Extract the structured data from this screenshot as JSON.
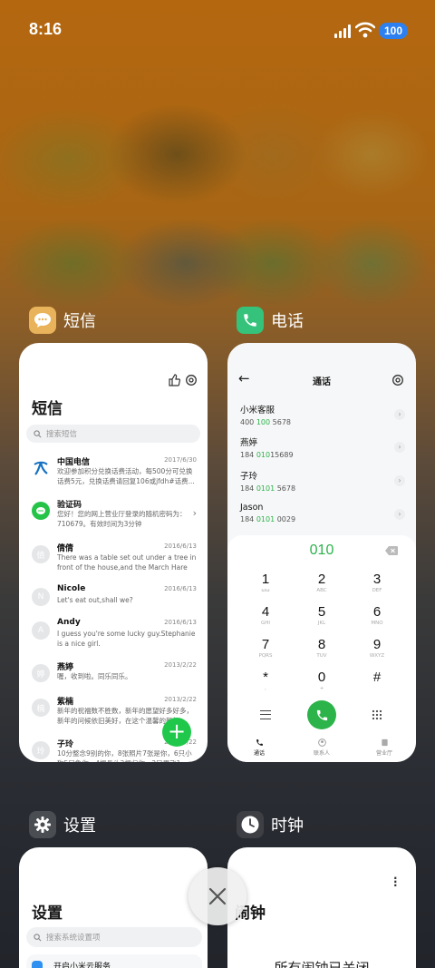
{
  "status_bar": {
    "time": "8:16",
    "battery": "100"
  },
  "apps": {
    "sms": {
      "name": "短信",
      "title": "短信",
      "search_placeholder": "搜索短信",
      "messages": [
        {
          "name": "中国电信",
          "date": "2017/6/30",
          "preview": "欢迎参加积分兑换话费活动，每500分可兑换话费5元，兑换话费请回复106或jfdh#话费..."
        },
        {
          "name": "验证码",
          "date": "",
          "preview": "您好！您的网上营业厅登录的随机密码为：710679。有效时间为3分钟"
        },
        {
          "name": "倩倩",
          "date": "2016/6/13",
          "avatar": "倩",
          "preview": "There was a table set out under a tree in front of the house,and the March Hare an..."
        },
        {
          "name": "Nicole",
          "date": "2016/6/13",
          "avatar": "N",
          "preview": "Let's eat out,shall we?"
        },
        {
          "name": "Andy",
          "date": "2016/6/13",
          "avatar": "A",
          "preview": "I guess you're some lucky guy.Stephanie is a nice girl."
        },
        {
          "name": "燕婷",
          "date": "2013/2/22",
          "avatar": "婷",
          "preview": "喔，收到啦。同乐同乐。"
        },
        {
          "name": "紫楠",
          "date": "2013/2/22",
          "avatar": "楠",
          "preview": "新年的祝福数不胜数，新年的愿望好多好多，新年的问候依旧美好，在这个温馨的新年..."
        },
        {
          "name": "子玲",
          "date": "2013/2/22",
          "avatar": "玲",
          "preview": "10分整念9别的你，8张照片7张是你，6只小狗5只象你，4根骨头3根归你，2只眉飞1..."
        }
      ]
    },
    "phone": {
      "name": "电话",
      "title": "通话",
      "contacts": [
        {
          "name": "小米客服",
          "pre": "400 ",
          "hl": "100",
          "post": " 5678"
        },
        {
          "name": "燕婷",
          "pre": "184 ",
          "hl": "010",
          "post": "15689"
        },
        {
          "name": "子玲",
          "pre": "184 ",
          "hl": "0101",
          "post": " 5678"
        },
        {
          "name": "Jason",
          "pre": "184 ",
          "hl": "0101",
          "post": " 0029"
        }
      ],
      "dialed": "010",
      "keys": [
        {
          "d": "1",
          "l": "ωω"
        },
        {
          "d": "2",
          "l": "ABC"
        },
        {
          "d": "3",
          "l": "DEF"
        },
        {
          "d": "4",
          "l": "GHI"
        },
        {
          "d": "5",
          "l": "JKL"
        },
        {
          "d": "6",
          "l": "MNO"
        },
        {
          "d": "7",
          "l": "PQRS"
        },
        {
          "d": "8",
          "l": "TUV"
        },
        {
          "d": "9",
          "l": "WXYZ"
        },
        {
          "d": "*",
          "l": ","
        },
        {
          "d": "0",
          "l": "+"
        },
        {
          "d": "#",
          "l": ""
        }
      ],
      "tabs": [
        "通话",
        "联系人",
        "营业厅"
      ]
    },
    "settings": {
      "name": "设置",
      "title": "设置",
      "search_placeholder": "搜索系统设置项",
      "first_item": "开启小米云服务"
    },
    "clock": {
      "name": "时钟",
      "title": "闹钟",
      "empty_text": "所有闹钟已关闭"
    }
  },
  "colors": {
    "accent_green": "#2cb34a",
    "battery_blue": "#2d80f0",
    "fab_green": "#1fc84a"
  }
}
